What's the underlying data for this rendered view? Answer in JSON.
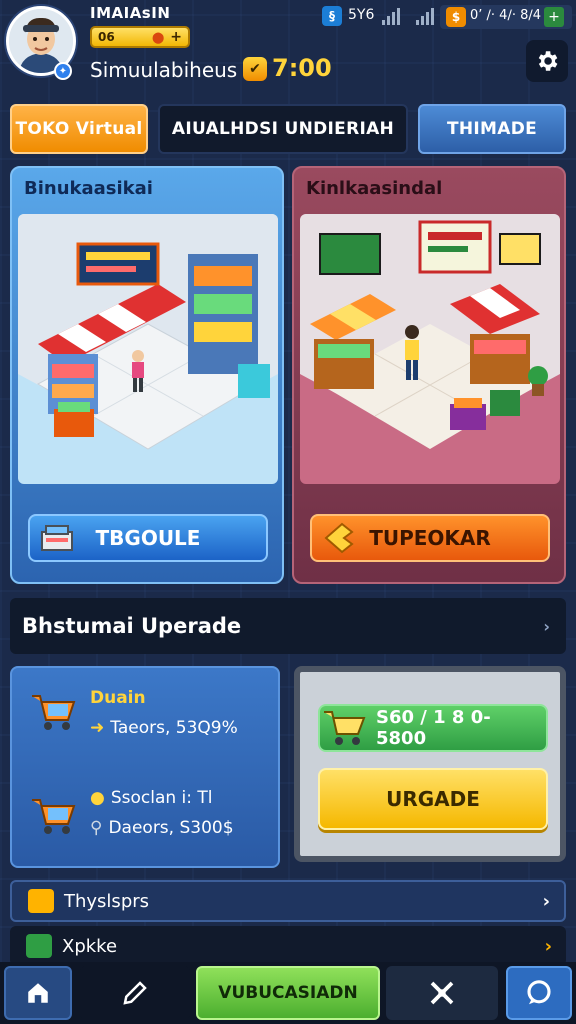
{
  "header": {
    "player_name": "IMAIAsIN",
    "level_text": "06",
    "shop_subtitle": "Simuulabiheus",
    "time_value": "7:00",
    "stat1_value": "5Y6",
    "stat2_value": "0’ ∕· 4∕· 8∕4"
  },
  "tabs": [
    {
      "label": "TOKO Virtual"
    },
    {
      "label": "AIUALHDSI UNDIERIAH"
    },
    {
      "label": "THIMADE"
    }
  ],
  "cards": {
    "left": {
      "title": "Binukaasikai",
      "button": "TBGOULE"
    },
    "right": {
      "title": "Kinlkaasindal",
      "button": "TUPEOKAR"
    }
  },
  "section": {
    "title": "Bhstumai Uperade"
  },
  "upgrade": {
    "item1_title": "Duain",
    "item1_line": "Taeors, 53Q9%",
    "item2_title": "Ssoclan i: Tl",
    "item2_line": "Daeors, S300$",
    "price": "S60 / 1 8 0- 5800",
    "upgrade_button": "URGADE"
  },
  "list": [
    {
      "label": "Thyslsprs"
    },
    {
      "label": "Xpkke"
    }
  ],
  "nav": {
    "main_label": "VUBUCASIADN"
  },
  "colors": {
    "background": "#1b2a4a",
    "accent_orange": "#f08c00",
    "accent_blue": "#2d6cc0",
    "accent_yellow": "#ffd43b",
    "accent_green": "#4caf2f"
  },
  "icons": [
    "avatar",
    "level-pin-icon",
    "plus-icon",
    "clock-icon",
    "stat-icon",
    "signal-icon",
    "settings-gear-icon",
    "cart-icon",
    "chevron-right-icon",
    "home-icon",
    "pencil-icon",
    "tools-icon",
    "chat-icon"
  ]
}
